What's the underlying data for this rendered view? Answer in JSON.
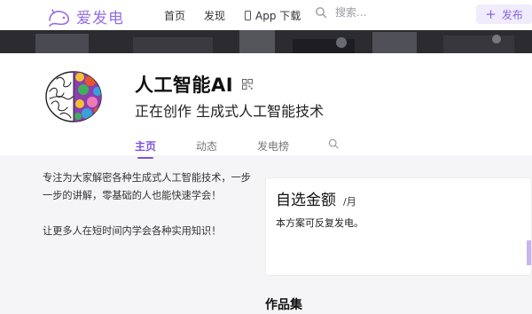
{
  "header": {
    "logo_text": "爱发电",
    "nav": [
      {
        "label": "首页"
      },
      {
        "label": "发现"
      },
      {
        "label": "App 下载",
        "icon": "phone-icon"
      }
    ],
    "search_placeholder": "搜索...",
    "publish_label": "发布"
  },
  "profile": {
    "name": "人工智能AI",
    "creating": "正在创作 生成式人工智能技术",
    "tabs": [
      {
        "label": "主页",
        "active": true
      },
      {
        "label": "动态"
      },
      {
        "label": "发电榜"
      }
    ]
  },
  "main": {
    "intro": [
      "专注为大家解密各种生成式人工智能技术，一步一步的讲解，零基础的人也能快速学会！",
      "让更多人在短时间内学会各种实用知识！"
    ],
    "plan": {
      "title": "自选金额",
      "unit": "/月",
      "description": "本方案可反复发电。"
    },
    "works_title": "作品集"
  },
  "colors": {
    "accent": "#7d52de",
    "logo": "#946ce6",
    "publish_bg": "#f1ecfc",
    "page_bg": "#f5f5f7"
  }
}
